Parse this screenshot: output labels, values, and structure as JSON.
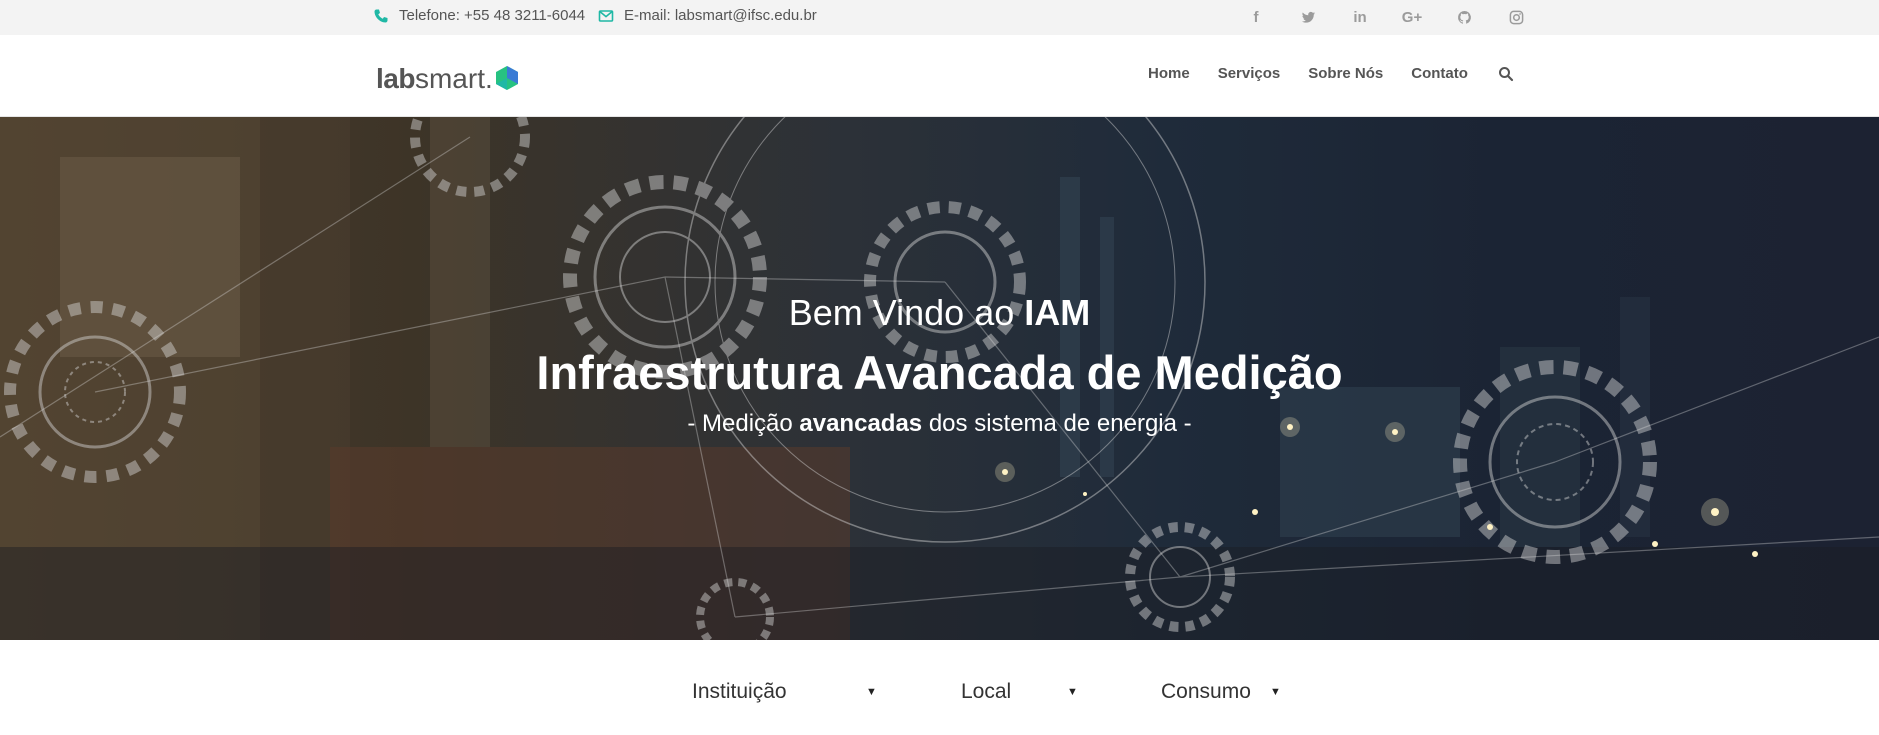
{
  "topbar": {
    "phone_label": "Telefone: +55 48 3211-6044",
    "email_label": "E-mail: labsmart@ifsc.edu.br",
    "social": [
      "facebook-icon",
      "twitter-icon",
      "linkedin-icon",
      "google-plus-icon",
      "github-icon",
      "instagram-icon"
    ],
    "social_glyphs": [
      "f",
      "",
      "in",
      "G+",
      "",
      ""
    ]
  },
  "header": {
    "logo_bold": "lab",
    "logo_rest": "smart.",
    "nav": [
      "Home",
      "Serviços",
      "Sobre Nós",
      "Contato"
    ]
  },
  "hero": {
    "line1_prefix": "Bem Vindo ao ",
    "line1_bold": "IAM",
    "title": "Infraestrutura Avancada de Medição",
    "sub_prefix": "- Medição ",
    "sub_bold": "avancadas",
    "sub_suffix": " dos sistema de energia -"
  },
  "filters": [
    {
      "label": "Instituição",
      "arrow": "▼"
    },
    {
      "label": "Local",
      "arrow": "▼"
    },
    {
      "label": "Consumo",
      "arrow": "▼"
    }
  ],
  "colors": {
    "accent": "#1fb8a5",
    "logo_blue": "#3a7bd5",
    "logo_green": "#27c281",
    "icon_gray": "#9b9b9b"
  }
}
